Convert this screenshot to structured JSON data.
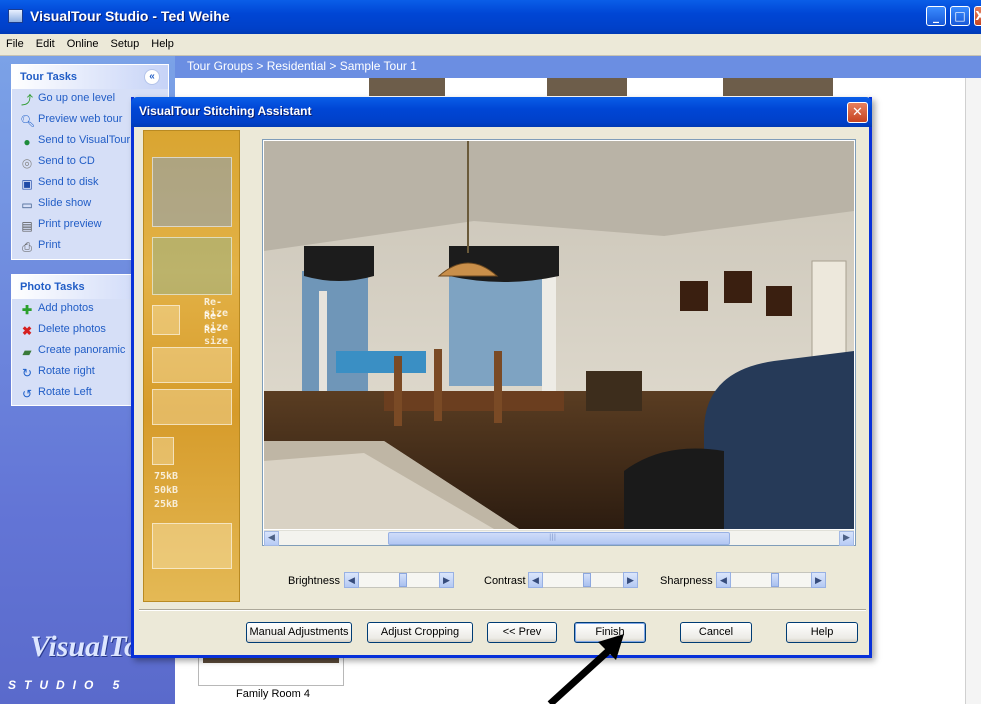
{
  "app": {
    "title": "VisualTour Studio - Ted Weihe",
    "window_buttons": {
      "minimize": "_",
      "maximize": "□",
      "close": "X"
    }
  },
  "menu": [
    "File",
    "Edit",
    "Online",
    "Setup",
    "Help"
  ],
  "tour_tasks": {
    "header": "Tour Tasks",
    "collapse_glyph": "«",
    "items": [
      {
        "label": "Go up one level",
        "icon": "up-folder-icon"
      },
      {
        "label": "Preview web tour",
        "icon": "magnifier-icon"
      },
      {
        "label": "Send to VisualTour",
        "icon": "globe-icon"
      },
      {
        "label": "Send to CD",
        "icon": "cd-icon"
      },
      {
        "label": "Send to disk",
        "icon": "floppy-icon"
      },
      {
        "label": "Slide show",
        "icon": "monitor-icon"
      },
      {
        "label": "Print preview",
        "icon": "print-preview-icon"
      },
      {
        "label": "Print",
        "icon": "printer-icon"
      }
    ]
  },
  "photo_tasks": {
    "header": "Photo Tasks",
    "items": [
      {
        "label": "Add photos",
        "icon": "add-icon"
      },
      {
        "label": "Delete photos",
        "icon": "delete-icon"
      },
      {
        "label": "Create panoramic",
        "icon": "panorama-icon"
      },
      {
        "label": "Rotate right",
        "icon": "rotate-right-icon"
      },
      {
        "label": "Rotate Left",
        "icon": "rotate-left-icon"
      }
    ]
  },
  "logo": {
    "word": "VisualTo",
    "sub": "STUDIO 5"
  },
  "breadcrumb": "Tour Groups > Residential > Sample Tour 1",
  "thumbnail_caption": "Family Room 4",
  "dialog": {
    "title": "VisualTour Stitching Assistant",
    "close_glyph": "✕",
    "side_art_labels": [
      "Re-size",
      "Re-size",
      "Re-size",
      "75kB",
      "50kB",
      "25kB"
    ],
    "sliders": [
      {
        "label": "Brightness",
        "level": 0.55
      },
      {
        "label": "Contrast",
        "level": 0.55
      },
      {
        "label": "Sharpness",
        "level": 0.55
      }
    ],
    "scrollbar_grip": "|||",
    "buttons": {
      "manual": "Manual Adjustments",
      "crop": "Adjust Cropping",
      "prev": "<< Prev",
      "finish": "Finish",
      "cancel": "Cancel",
      "help": "Help"
    }
  },
  "colors": {
    "xp_blue": "#0046d5",
    "taskpane": "#6b8ee2",
    "dialog_bg": "#ece9d8",
    "side_art": "#dcaa38"
  }
}
